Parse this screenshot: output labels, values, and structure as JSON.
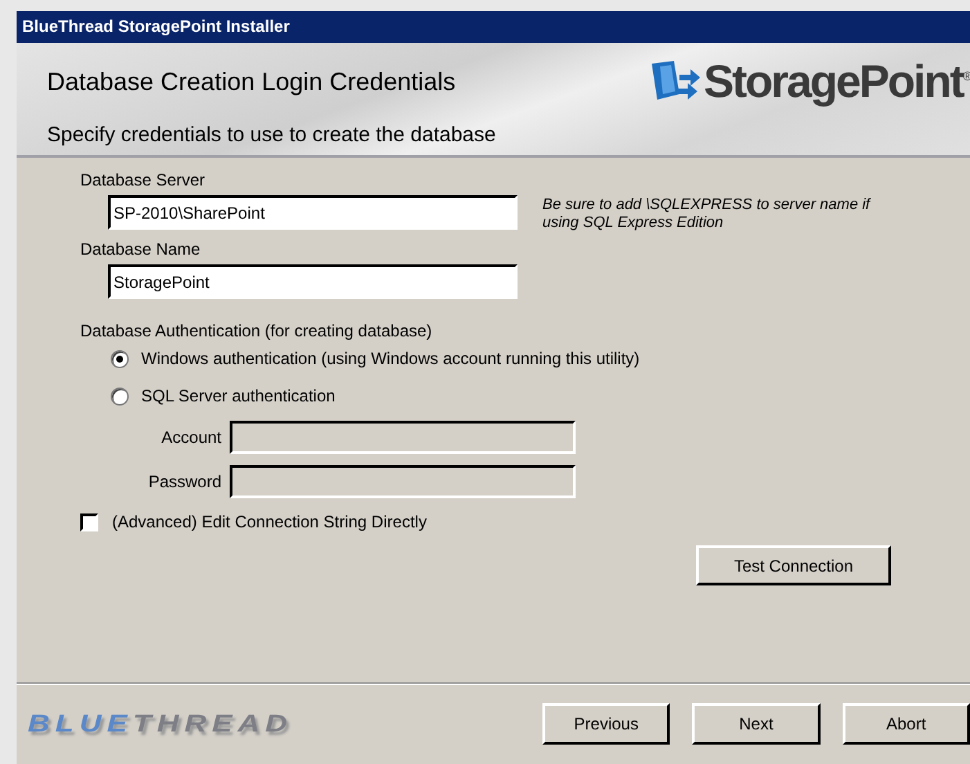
{
  "window": {
    "title": "BlueThread StoragePoint Installer"
  },
  "header": {
    "title": "Database Creation Login Credentials",
    "subtitle": "Specify credentials to use to create the database",
    "logo": {
      "text": "StoragePoint",
      "mark": "®"
    }
  },
  "server": {
    "label": "Database Server",
    "value": "SP-2010\\SharePoint",
    "hint": "Be sure to add \\SQLEXPRESS to server name if using SQL Express Edition"
  },
  "database": {
    "label": "Database Name",
    "value": "StoragePoint"
  },
  "authentication": {
    "label": "Database Authentication (for creating database)",
    "options": [
      {
        "label": "Windows authentication (using Windows account running this utility)",
        "selected": true
      },
      {
        "label": "SQL Server authentication",
        "selected": false
      }
    ]
  },
  "credentials": [
    {
      "label": "Account",
      "disabled": true
    },
    {
      "label": "Password",
      "disabled": true
    }
  ],
  "advanced": {
    "label": "(Advanced) Edit Connection String Directly",
    "checked": false
  },
  "test_button": "Test Connection",
  "footer": {
    "brand": {
      "first": "BLUE",
      "second": "THREAD"
    },
    "buttons": [
      "Previous",
      "Next",
      "Abort"
    ]
  }
}
